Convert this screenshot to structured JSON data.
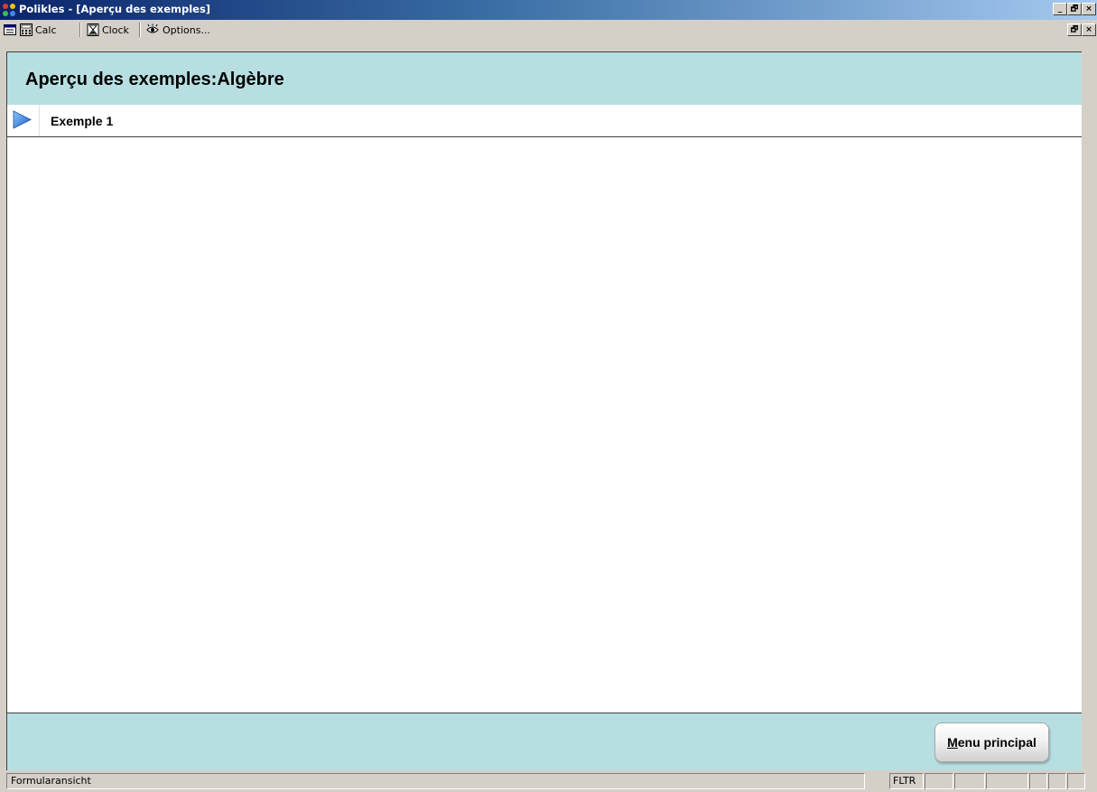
{
  "window": {
    "title": "Polikles - [Aperçu des exemples]",
    "controls": {
      "minimize": "_",
      "restore": "🗗",
      "close": "×"
    },
    "child_controls": {
      "restore": "🗗",
      "close": "×"
    }
  },
  "toolbar": {
    "items": [
      {
        "label": "",
        "icon": "form-icon"
      },
      {
        "label": "Calc",
        "icon": "calculator-icon"
      },
      {
        "label": "Clock",
        "icon": "hourglass-icon"
      },
      {
        "label": "Options...",
        "icon": "eye-icon"
      }
    ]
  },
  "form": {
    "title": "Aperçu des exemples:Algèbre",
    "records": [
      {
        "label": "Exemple 1"
      }
    ],
    "footer_button": {
      "label": "Menu principal",
      "accelerator": "M",
      "rest": "enu principal"
    }
  },
  "statusbar": {
    "text": "Formularansicht",
    "indicator": "FLTR"
  },
  "colors": {
    "header_bg": "#b7dfe1",
    "footer_bg": "#b7dfe1",
    "titlebar_start": "#0a246a",
    "titlebar_end": "#a6caf0",
    "selector_arrow": "#2a7fdc"
  }
}
